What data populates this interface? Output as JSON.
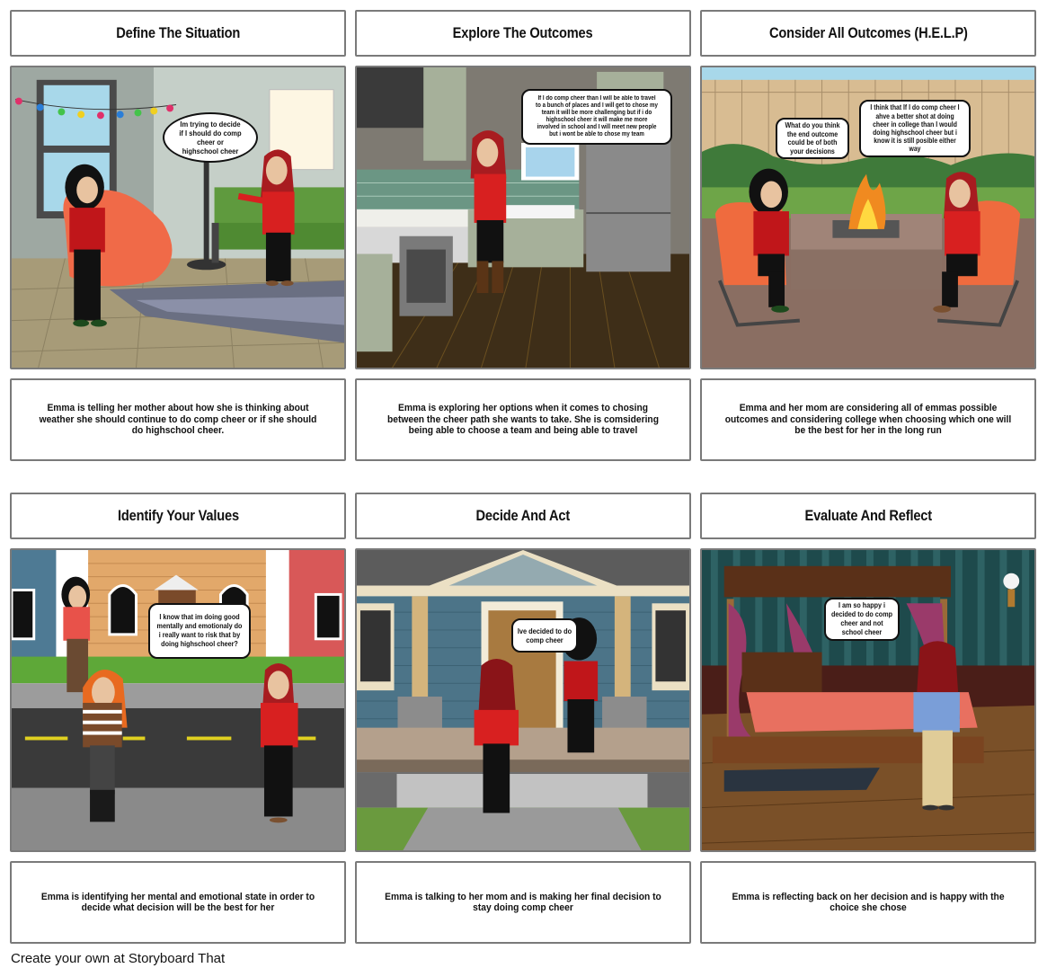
{
  "storyboard": {
    "panels": [
      {
        "title": "Define The Situation",
        "scene": "living-room",
        "bubbles": [
          "Im trying to decide if I should do comp cheer or highschool cheer"
        ],
        "description": "Emma is telling her mother about how she is thinking about weather she should continue to do comp cheer or if she should do highschool cheer."
      },
      {
        "title": "Explore The Outcomes",
        "scene": "kitchen",
        "bubbles": [
          "If I do comp cheer than I will be able to travel to a bunch of places and I will get to chose my team it will be more challenging but if i do highschool cheer it will make me more involved in school and I will meet new people but i wont be able to chose my team"
        ],
        "description": "Emma is exploring her options when it comes to chosing between the cheer path she wants to take. She is comsidering being able to choose a team and being able to travel"
      },
      {
        "title": "Consider All Outcomes (H.E.L.P)",
        "scene": "backyard-fire-pit",
        "bubbles": [
          "What do you think the end outcome could be of both your decisions",
          "I think that If I do comp cheer I ahve a better shot at doing cheer in college than I would doing highschool cheer but i know it is still posible either way"
        ],
        "description": "Emma and her mom are considering all of emmas possible outcomes and considering college when choosing which one will be the best for her in the long run"
      },
      {
        "title": "Identify Your Values",
        "scene": "street",
        "bubbles": [
          "I know that im doing good mentally and emotionaly do i really want to risk that by doing highschool cheer?"
        ],
        "description": "Emma is identifying her mental and emotional state in order to decide what decision will be the best for her"
      },
      {
        "title": "Decide And Act",
        "scene": "house-porch",
        "bubbles": [
          "Ive decided to do comp cheer"
        ],
        "description": "Emma is talking to her mom and is making her final decision to stay doing comp cheer"
      },
      {
        "title": "Evaluate And Reflect",
        "scene": "bedroom",
        "bubbles": [
          "I am so happy i decided to do comp cheer and not school cheer"
        ],
        "description": "Emma is reflecting back on her decision and is happy with the choice she chose"
      }
    ]
  },
  "footer": {
    "text": "Create your own at Storyboard That"
  }
}
